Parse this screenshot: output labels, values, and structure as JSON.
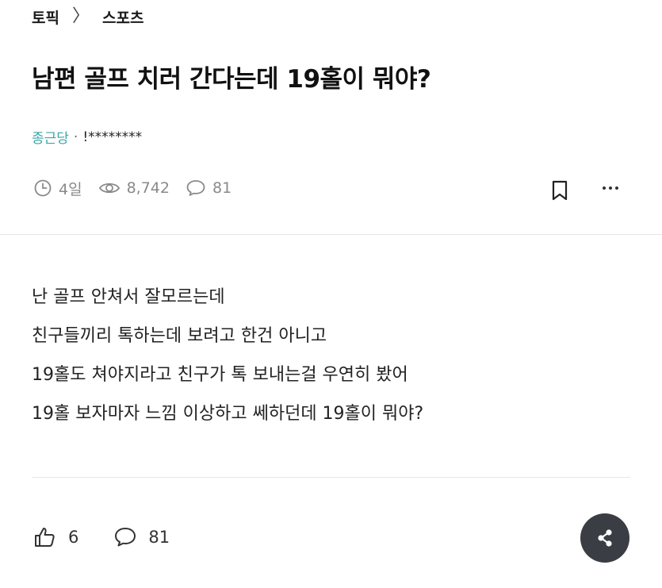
{
  "breadcrumb": {
    "topic": "토픽",
    "separator": "〉",
    "category": "스포츠"
  },
  "post": {
    "title": "남편 골프 치러 간다는데 19홀이 뭐야?",
    "author_topic": "종근당",
    "dot": "·",
    "author_masked": "!********",
    "time": "4일",
    "views": "8,742",
    "comments": "81",
    "body_lines": [
      "난 골프 안쳐서 잘모르는데",
      "친구들끼리 톡하는데 보려고 한건 아니고",
      "19홀도 쳐야지라고 친구가 톡 보내는걸 우연히 봤어",
      "19홀 보자마자 느낌 이상하고 쎄하던데 19홀이 뭐야?"
    ]
  },
  "footer": {
    "likes": "6",
    "comments": "81"
  },
  "icons": {
    "clock": "clock-icon",
    "eye": "eye-icon",
    "comment": "comment-icon",
    "bookmark": "bookmark-icon",
    "more": "more-icon",
    "like": "thumbs-up-icon",
    "share": "share-icon"
  },
  "colors": {
    "accent_teal": "#3aa6a6",
    "meta_gray": "#8a8a8a",
    "share_bg": "#3a3d44"
  }
}
